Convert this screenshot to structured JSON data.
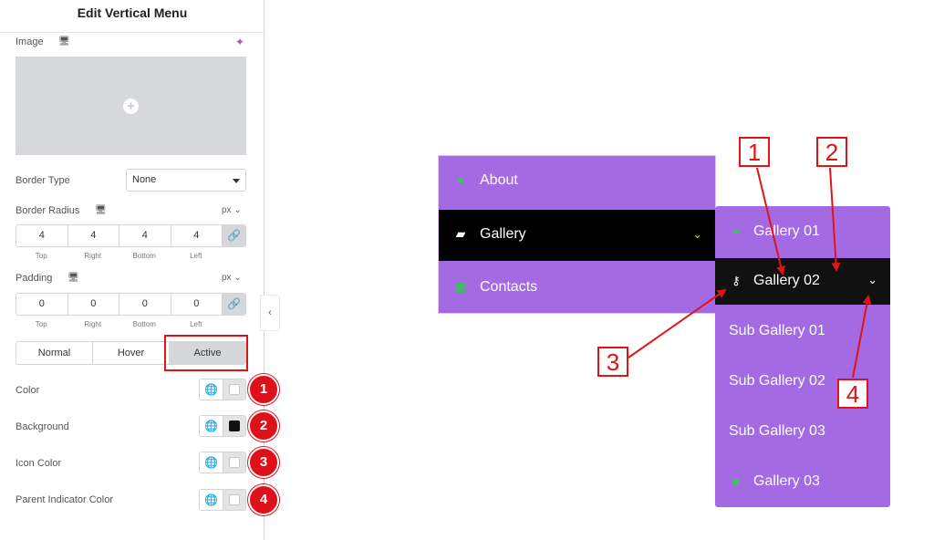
{
  "panel": {
    "title": "Edit Vertical Menu",
    "image_label": "Image",
    "border_type_label": "Border Type",
    "border_type_value": "None",
    "border_radius_label": "Border Radius",
    "border_radius_unit": "px ⌄",
    "border_radius_values": [
      "4",
      "4",
      "4",
      "4"
    ],
    "padding_label": "Padding",
    "padding_unit": "px ⌄",
    "padding_values": [
      "0",
      "0",
      "0",
      "0"
    ],
    "sides": [
      "Top",
      "Right",
      "Bottom",
      "Left"
    ],
    "tabs": [
      "Normal",
      "Hover",
      "Active"
    ],
    "active_tab": "Active",
    "controls": [
      {
        "label": "Color",
        "badge": "1",
        "swatch": "#ffffff"
      },
      {
        "label": "Background",
        "badge": "2",
        "swatch": "#111111"
      },
      {
        "label": "Icon Color",
        "badge": "3",
        "swatch": "#ffffff"
      },
      {
        "label": "Parent Indicator Color",
        "badge": "4",
        "swatch": "#ffffff"
      }
    ]
  },
  "preview": {
    "menu_items": [
      {
        "label": "About",
        "icon": "user-icon"
      },
      {
        "label": "Gallery",
        "icon": "folder-open-icon",
        "active": true
      },
      {
        "label": "Contacts",
        "icon": "address-book-icon"
      }
    ],
    "submenu_items": [
      {
        "label": "Gallery 01",
        "icon": "leaf-icon"
      },
      {
        "label": "Gallery 02",
        "icon": "key-icon",
        "active": true
      },
      {
        "label": "Sub Gallery 01"
      },
      {
        "label": "Sub Gallery 02"
      },
      {
        "label": "Sub Gallery 03"
      },
      {
        "label": "Gallery 03",
        "icon": "square-icon"
      }
    ],
    "annotations": [
      "1",
      "2",
      "3",
      "4"
    ]
  },
  "colors": {
    "menu_bg": "#a46ae3",
    "active_bg": "#000000",
    "icon_green": "#37c65a",
    "annotation_red": "#e01414"
  }
}
